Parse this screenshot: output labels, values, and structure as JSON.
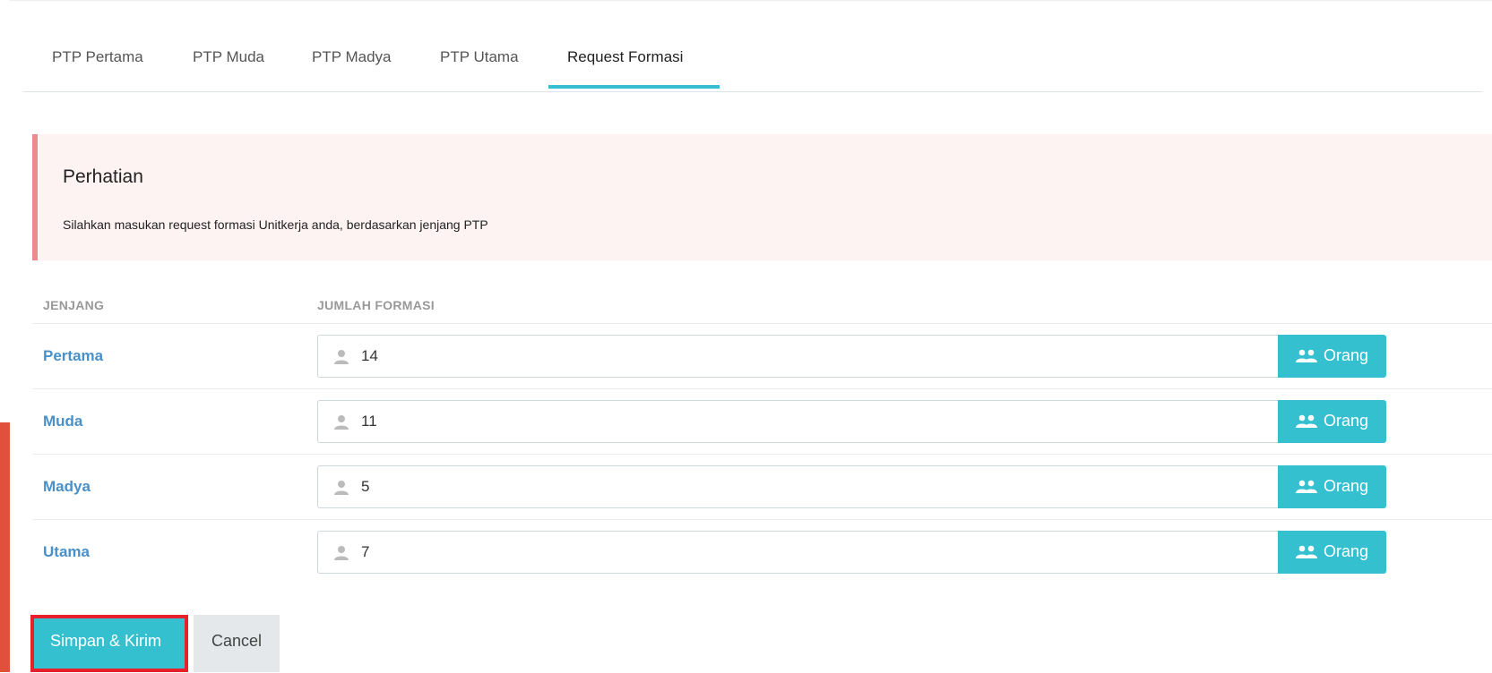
{
  "tabs": [
    {
      "label": "PTP Pertama",
      "active": false
    },
    {
      "label": "PTP Muda",
      "active": false
    },
    {
      "label": "PTP Madya",
      "active": false
    },
    {
      "label": "PTP Utama",
      "active": false
    },
    {
      "label": "Request Formasi",
      "active": true
    }
  ],
  "alert": {
    "title": "Perhatian",
    "message": "Silahkan masukan request formasi Unitkerja anda, berdasarkan jenjang PTP"
  },
  "table": {
    "headers": {
      "jenjang": "JENJANG",
      "jumlah": "JUMLAH FORMASI"
    },
    "rows": [
      {
        "jenjang": "Pertama",
        "value": "14",
        "addon": "Orang"
      },
      {
        "jenjang": "Muda",
        "value": "11",
        "addon": "Orang"
      },
      {
        "jenjang": "Madya",
        "value": "5",
        "addon": "Orang"
      },
      {
        "jenjang": "Utama",
        "value": "7",
        "addon": "Orang"
      }
    ]
  },
  "actions": {
    "save_label": "Simpan & Kirim",
    "cancel_label": "Cancel"
  },
  "icons": {
    "input": "user-icon",
    "addon": "users-icon"
  },
  "colors": {
    "accent": "#35c0cf",
    "alert_border": "#eb8a8f",
    "alert_bg": "#fdf3f3",
    "label_blue": "#4a90c8",
    "highlight": "#e8202a"
  }
}
